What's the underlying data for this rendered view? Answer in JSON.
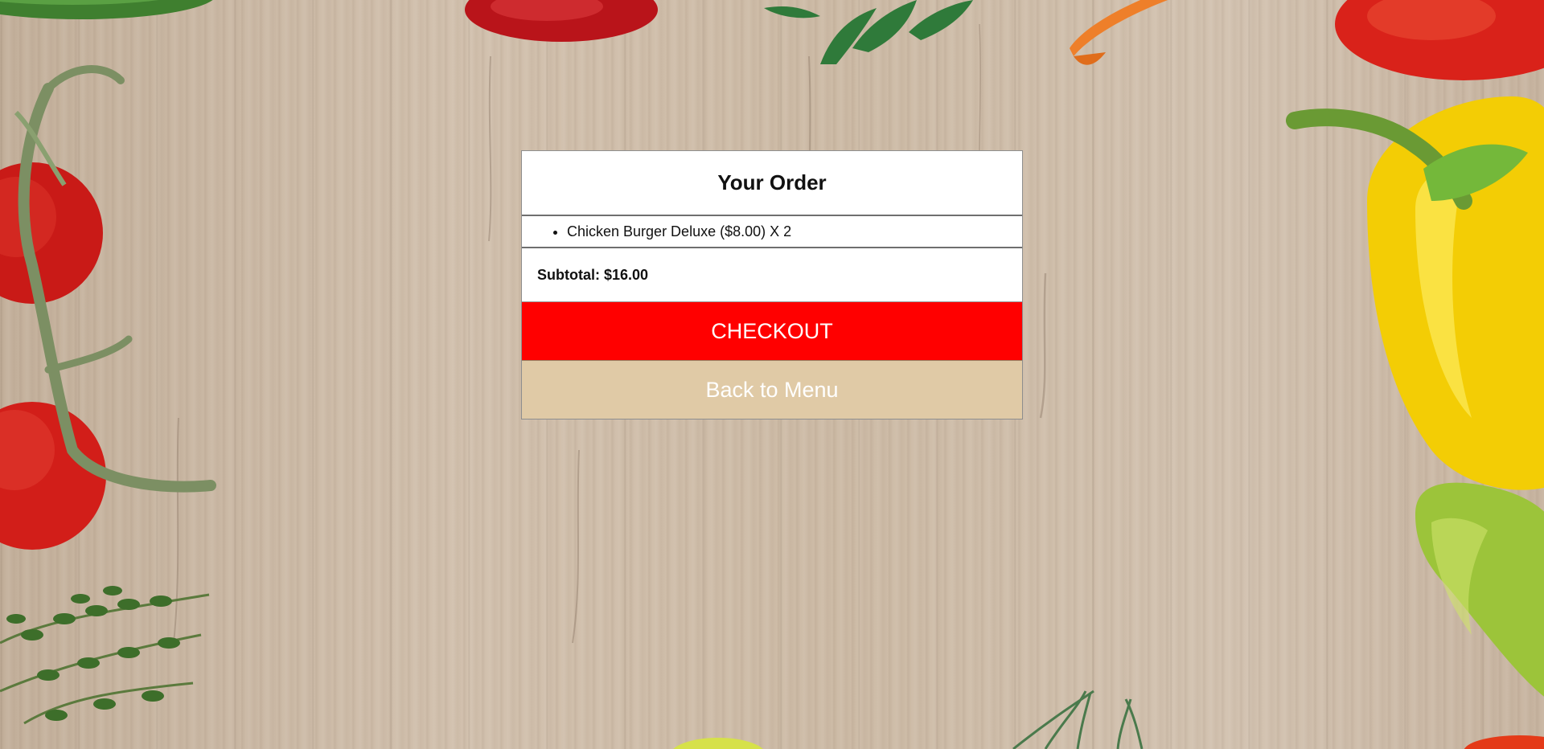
{
  "order": {
    "title": "Your Order",
    "items": [
      {
        "name": "Chicken Burger Deluxe",
        "price": "($8.00)",
        "quantity_text": "X 2"
      }
    ],
    "subtotal_label": "Subtotal:",
    "subtotal_value": "$16.00"
  },
  "actions": {
    "checkout_label": "CHECKOUT",
    "back_label": "Back to Menu"
  },
  "colors": {
    "checkout_bg": "#ff0000",
    "back_bg": "#e0caa6",
    "panel_bg": "#ffffff"
  },
  "background": {
    "theme": "wooden-table-with-vegetables",
    "decorations": [
      "tomato",
      "parsley",
      "carrot",
      "yellow-bell-pepper",
      "green-pepper",
      "thyme",
      "rosemary"
    ]
  }
}
